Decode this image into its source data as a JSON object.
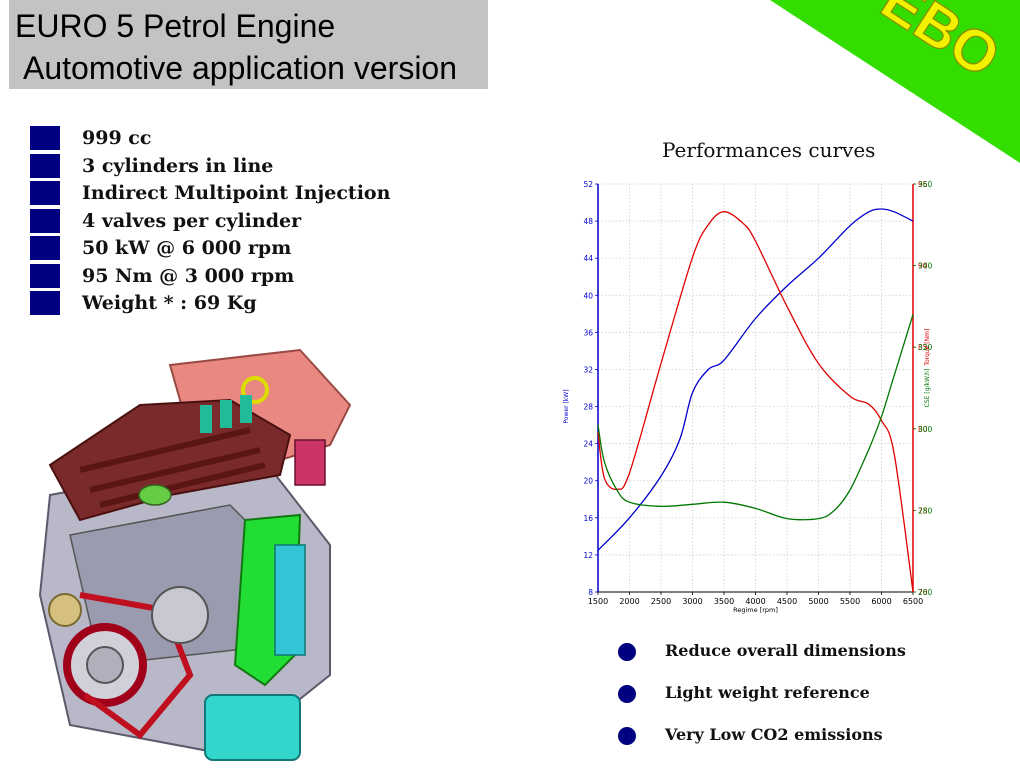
{
  "header": {
    "title_line1": "EURO 5 Petrol Engine",
    "title_line2": "Automotive application version"
  },
  "badge": {
    "text": "EBO",
    "color": "#33dd00",
    "text_color": "#f2f200"
  },
  "specs": [
    "999 cc",
    "3 cylinders in line",
    "Indirect Multipoint Injection",
    "4 valves per cylinder",
    "50 kW @ 6 000 rpm",
    "95 Nm @ 3 000 rpm",
    "Weight * : 69 Kg"
  ],
  "colors": {
    "bullet": "#000080",
    "power": "#0000cc",
    "torque": "#e00000",
    "cse": "#007700"
  },
  "benefits": [
    "Reduce overall dimensions",
    "Light weight reference",
    "Very Low CO2 emissions"
  ],
  "chart_data": {
    "type": "line",
    "title": "Performances curves",
    "xlabel": "Regime [rpm]",
    "xlim": [
      1500,
      6500
    ],
    "xticks": [
      1500,
      2000,
      2500,
      3000,
      3500,
      4000,
      4500,
      5000,
      5500,
      6000,
      6500
    ],
    "y_left": {
      "label": "Power [kW]",
      "lim": [
        8,
        52
      ],
      "ticks": [
        8,
        12,
        16,
        20,
        24,
        28,
        32,
        36,
        40,
        44,
        48,
        52
      ]
    },
    "y_right_torque": {
      "label": "Torque [Nm]",
      "lim": [
        70,
        95
      ],
      "ticks": [
        70,
        75,
        80,
        85,
        90,
        95
      ]
    },
    "y_right_cse": {
      "label": "CSE [g/kW.h]",
      "lim": [
        260,
        360
      ],
      "ticks": [
        260,
        280,
        300,
        320,
        340,
        360
      ]
    },
    "grid": true,
    "series": [
      {
        "axis": "power",
        "color": "#0000cc",
        "x": [
          1500,
          2000,
          2500,
          2800,
          3000,
          3250,
          3500,
          4000,
          4500,
          5000,
          5500,
          5800,
          6000,
          6200,
          6500
        ],
        "y": [
          12.5,
          16.0,
          20.5,
          24.5,
          29.5,
          32.0,
          33.0,
          37.5,
          41.0,
          44.0,
          47.5,
          49.0,
          49.3,
          49.0,
          48.0
        ]
      },
      {
        "axis": "torque",
        "color": "#e00000",
        "x": [
          1500,
          1600,
          1800,
          2000,
          2500,
          3000,
          3250,
          3500,
          3800,
          4000,
          4500,
          5000,
          5500,
          5800,
          6000,
          6200,
          6500
        ],
        "y": [
          79.8,
          77.0,
          76.3,
          77.3,
          84.0,
          90.5,
          92.5,
          93.3,
          92.6,
          91.5,
          87.5,
          84.0,
          82.0,
          81.5,
          80.5,
          78.5,
          70.0
        ]
      },
      {
        "axis": "cse",
        "color": "#007700",
        "x": [
          1500,
          1600,
          1800,
          2000,
          2500,
          3000,
          3500,
          4000,
          4500,
          5000,
          5250,
          5500,
          5800,
          6000,
          6200,
          6500
        ],
        "y": [
          301,
          292,
          285,
          282,
          281,
          281.5,
          282,
          280.5,
          278,
          278,
          280,
          285,
          295,
          303,
          313,
          328
        ]
      }
    ]
  }
}
